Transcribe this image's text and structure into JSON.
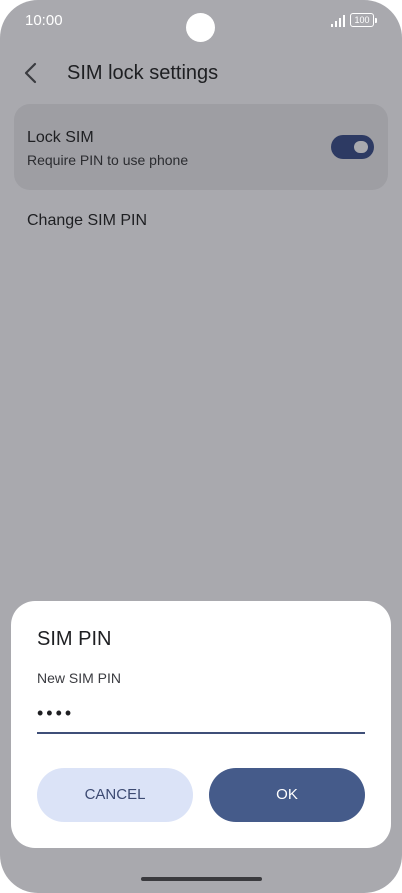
{
  "status": {
    "time": "10:00",
    "battery": "100"
  },
  "header": {
    "title": "SIM lock settings"
  },
  "lock_sim": {
    "title": "Lock SIM",
    "subtitle": "Require PIN to use phone",
    "enabled": true
  },
  "change_pin": {
    "label": "Change SIM PIN"
  },
  "dialog": {
    "title": "SIM PIN",
    "field_label": "New SIM PIN",
    "pin_value": "••••",
    "cancel_label": "CANCEL",
    "ok_label": "OK"
  },
  "colors": {
    "accent": "#455b8a",
    "toggle_on": "#2d3a63",
    "cancel_bg": "#dbe3f7",
    "scrim": "#a9a9ae"
  },
  "icons": {
    "back": "back-arrow-icon",
    "signal": "signal-icon",
    "battery": "battery-icon"
  }
}
